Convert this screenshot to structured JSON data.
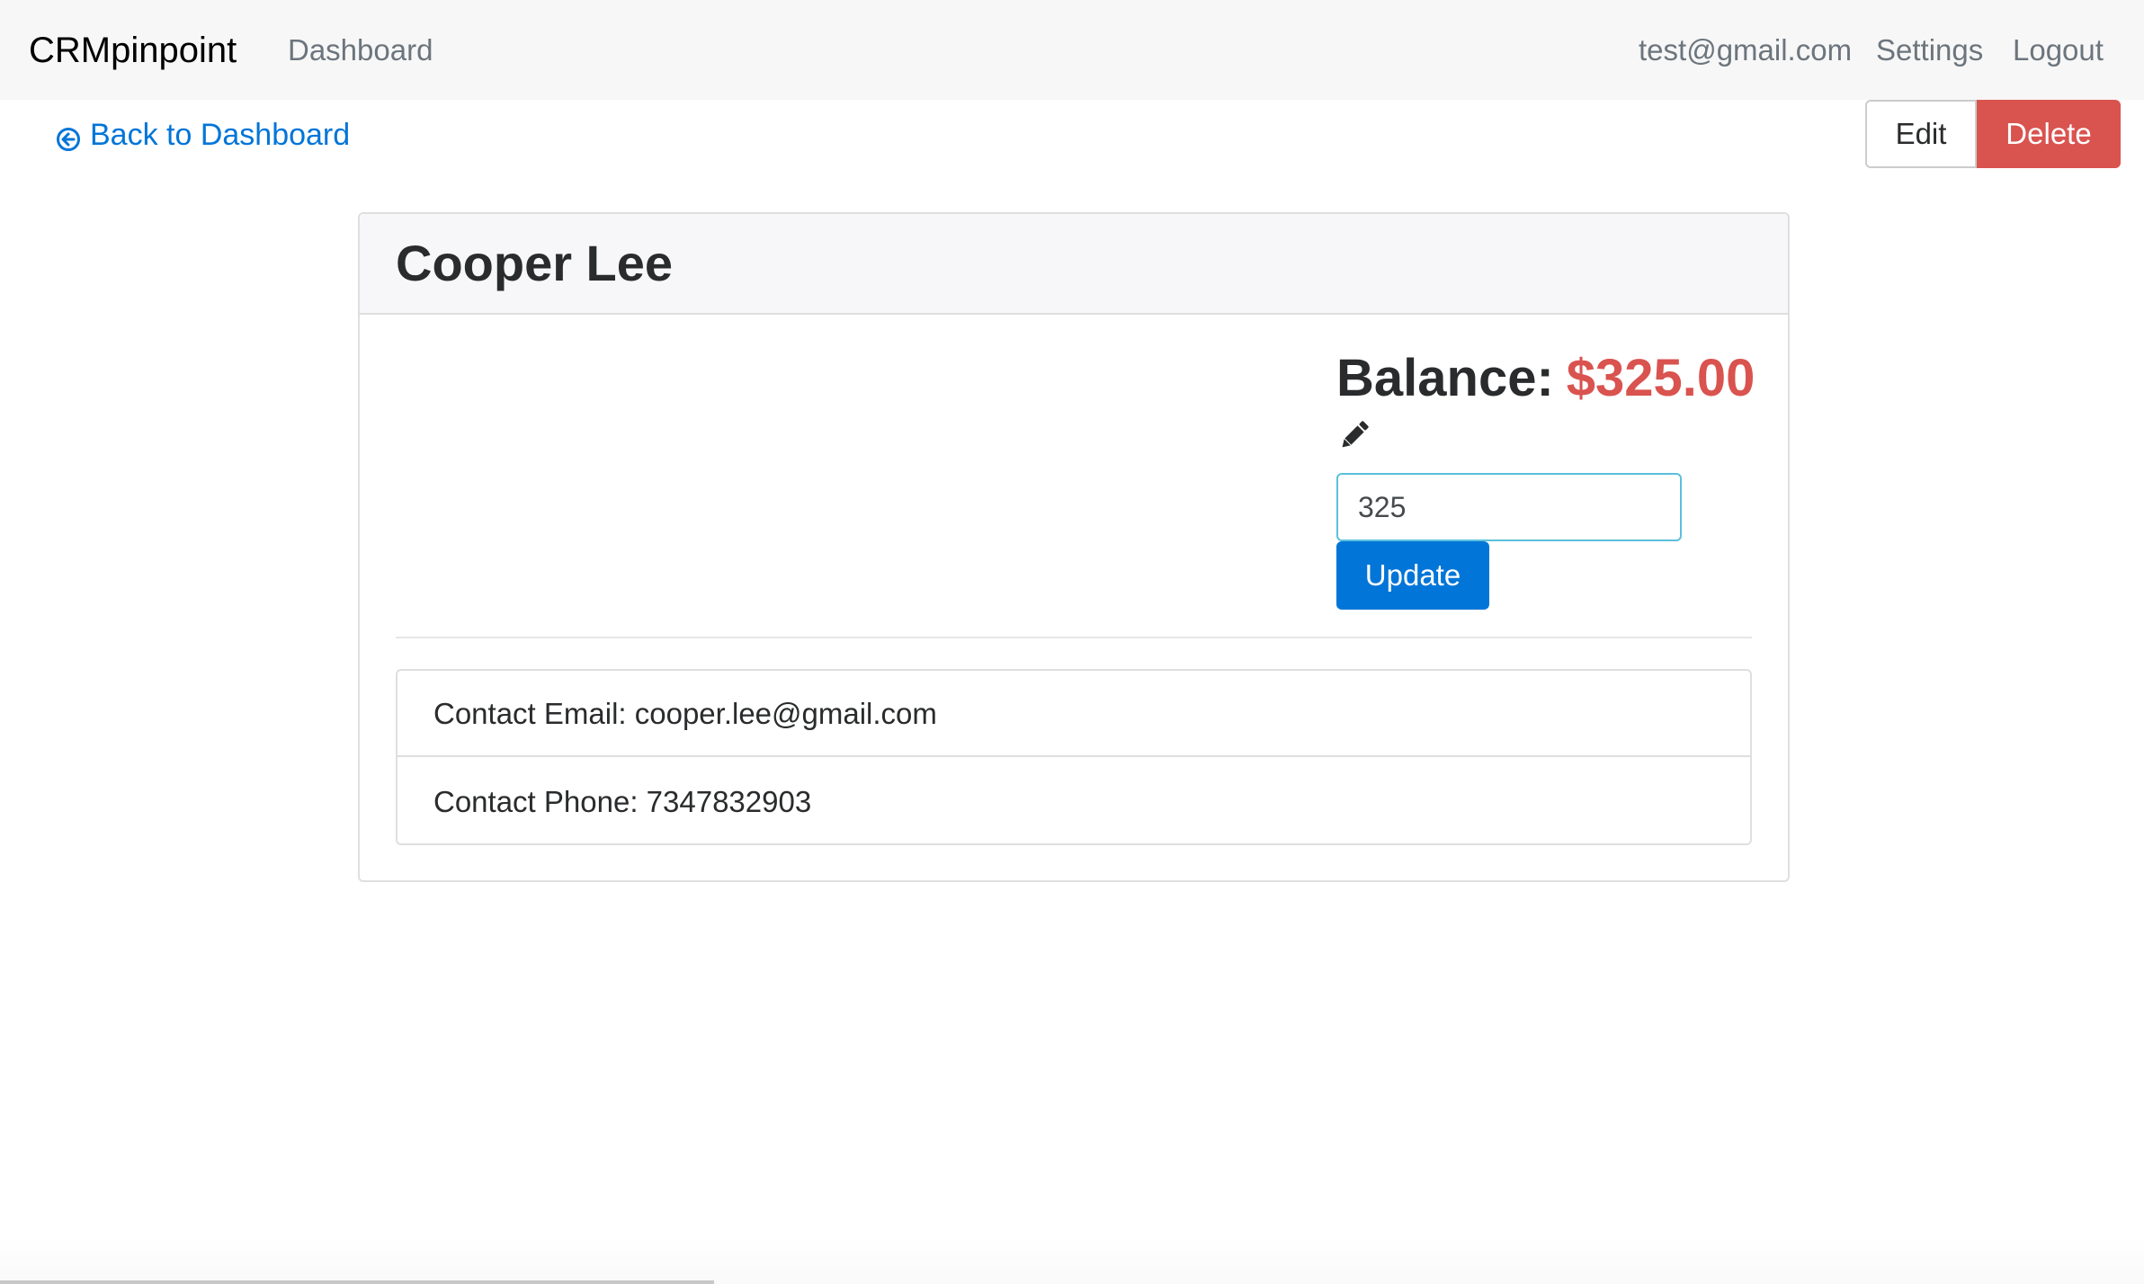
{
  "navbar": {
    "brand": "CRMpinpoint",
    "dashboard_link": "Dashboard",
    "user_email": "test@gmail.com",
    "settings_link": "Settings",
    "logout_link": "Logout"
  },
  "toolbar": {
    "back_label": "Back to Dashboard",
    "edit_label": "Edit",
    "delete_label": "Delete"
  },
  "customer": {
    "name": "Cooper Lee",
    "balance_label": "Balance:",
    "balance_amount": "$325.00",
    "balance_input_value": "325",
    "update_label": "Update",
    "email_line": "Contact Email: cooper.lee@gmail.com",
    "phone_line": "Contact Phone: 7347832903"
  },
  "colors": {
    "primary": "#0275d8",
    "danger": "#d9534f",
    "navbar_bg": "#f7f7f7"
  },
  "icons": {
    "back": "arrow-circle-left-icon",
    "edit_balance": "pencil-icon"
  }
}
